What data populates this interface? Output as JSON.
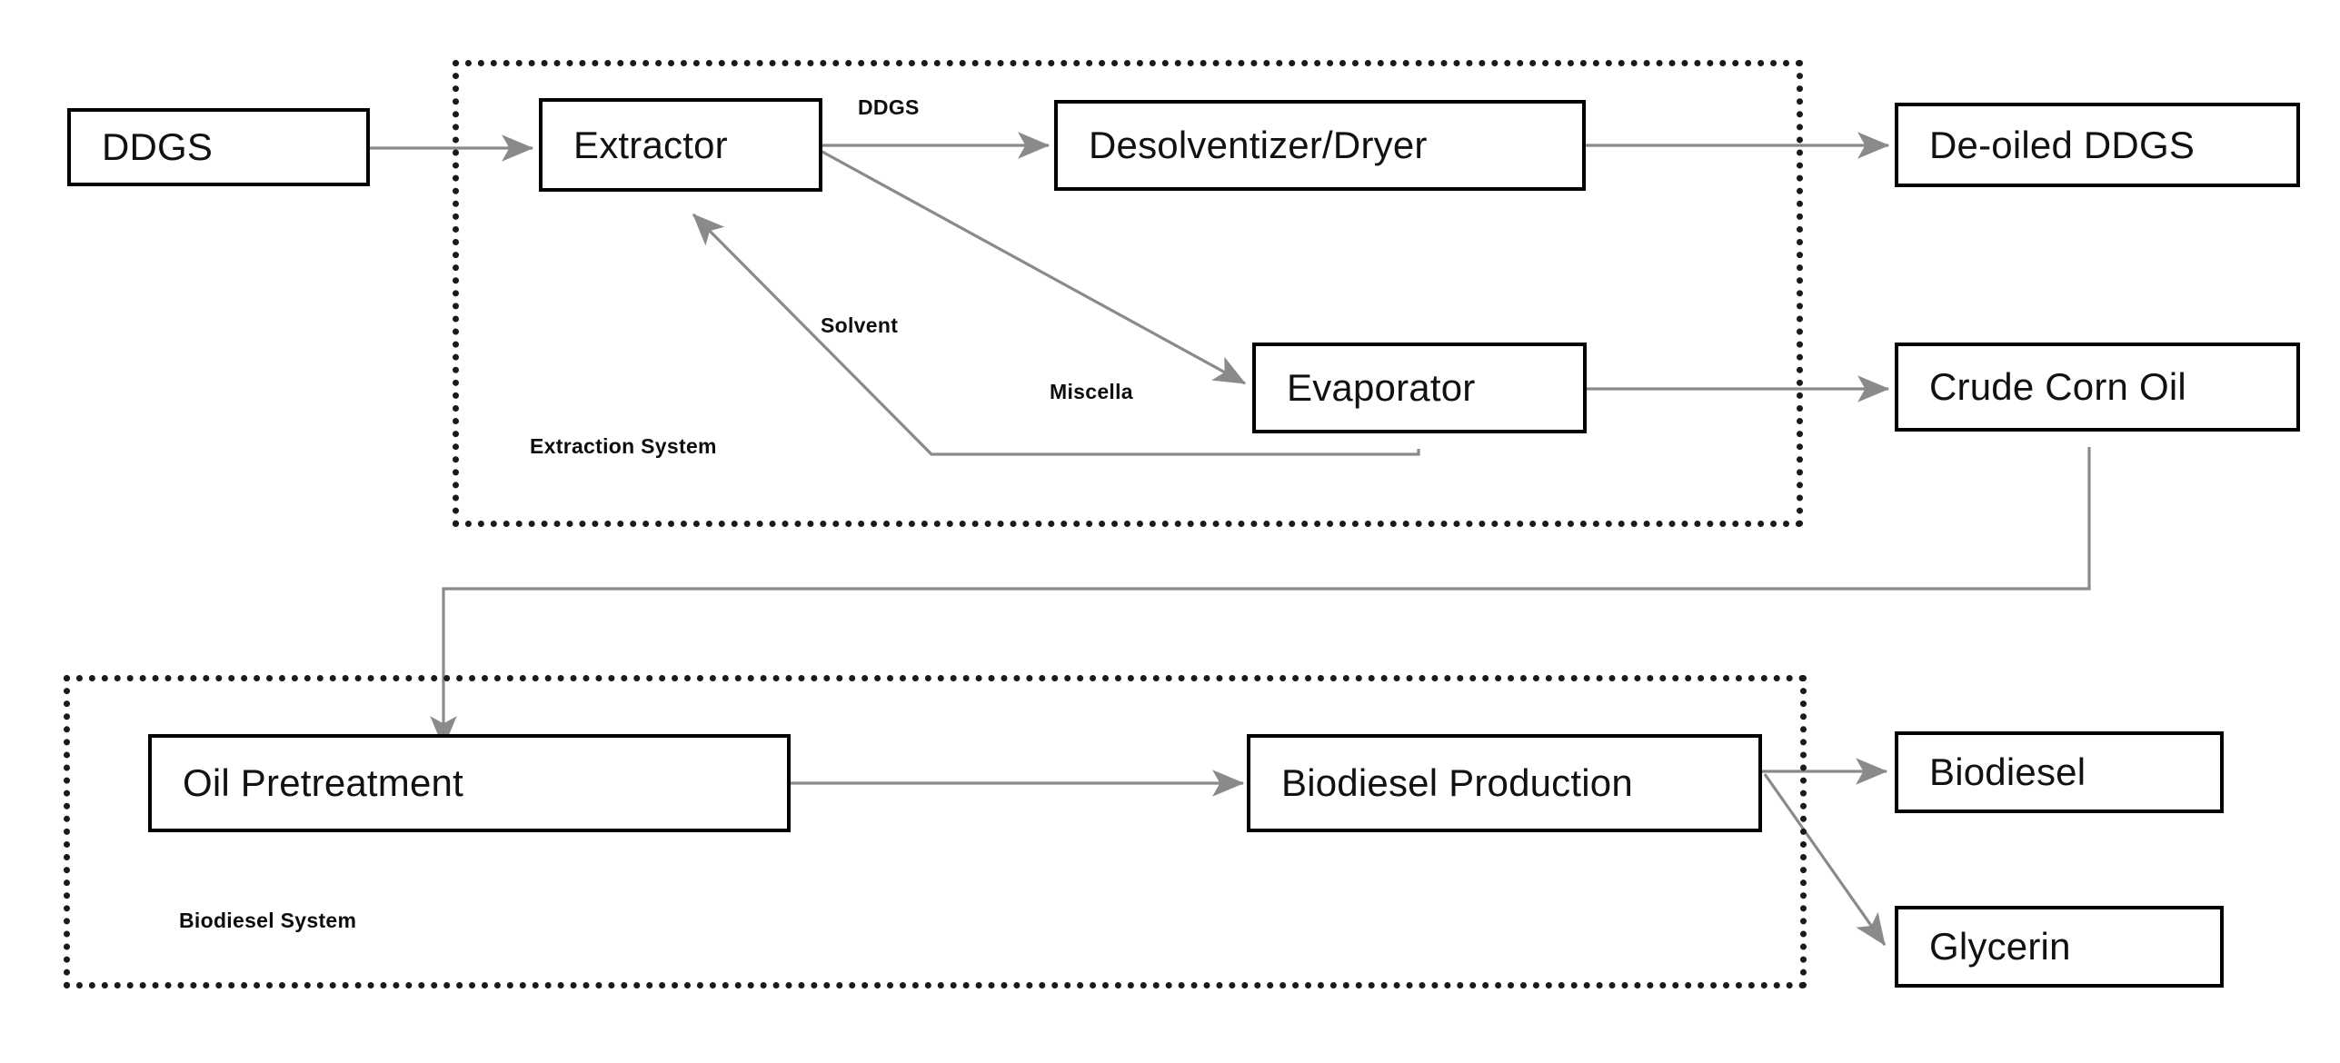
{
  "diagram": {
    "title": "DDGS corn oil extraction and biodiesel production flow diagram",
    "line_color": "#808080",
    "box_border_color": "#000000",
    "group_border_color": "#1a1a1a",
    "background": "#ffffff"
  },
  "nodes": {
    "ddgs": {
      "label": "DDGS"
    },
    "extractor": {
      "label": "Extractor"
    },
    "desolventizer": {
      "label": "Desolventizer/Dryer"
    },
    "deoiled_ddgs": {
      "label": "De-oiled DDGS"
    },
    "evaporator": {
      "label": "Evaporator"
    },
    "crude_corn_oil": {
      "label": "Crude Corn Oil"
    },
    "oil_pretreatment": {
      "label": "Oil Pretreatment"
    },
    "biodiesel_production": {
      "label": "Biodiesel Production"
    },
    "biodiesel": {
      "label": "Biodiesel"
    },
    "glycerin": {
      "label": "Glycerin"
    }
  },
  "groups": {
    "extraction_system": {
      "label": "Extraction System"
    },
    "biodiesel_system": {
      "label": "Biodiesel System"
    }
  },
  "edge_labels": {
    "ddgs_stream": "DDGS",
    "solvent": "Solvent",
    "miscella": "Miscella"
  }
}
